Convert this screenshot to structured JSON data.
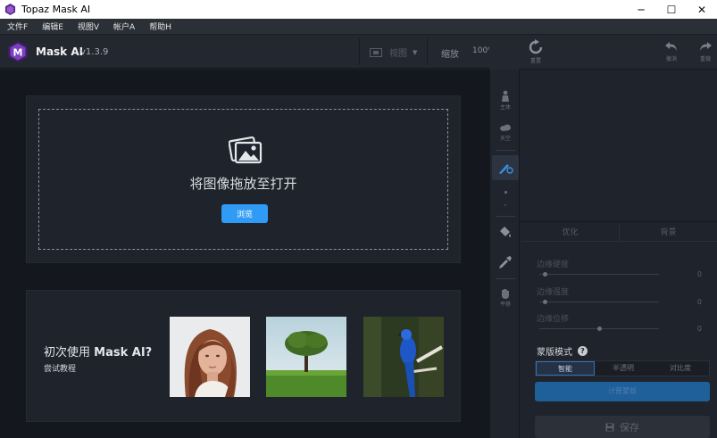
{
  "window": {
    "title": "Topaz Mask AI",
    "min_glyph": "─",
    "max_glyph": "☐",
    "close_glyph": "✕"
  },
  "menu": [
    {
      "label": "文件F"
    },
    {
      "label": "编辑E"
    },
    {
      "label": "视图V"
    },
    {
      "label": "帐户A"
    },
    {
      "label": "帮助H"
    }
  ],
  "toolbar": {
    "app_name": "Mask AI",
    "version": "v1.3.9",
    "view_label": "视图",
    "zoom_label": "缩放",
    "zoom_value": "100%"
  },
  "drop": {
    "text": "将图像拖放至打开",
    "browse_label": "浏览"
  },
  "tutorial": {
    "title_prefix": "初次使用 ",
    "title_bold": "Mask AI?",
    "subtitle": "尝试教程"
  },
  "tools": [
    {
      "name": "主体",
      "label": "主体"
    },
    {
      "name": "天空",
      "label": "天空"
    },
    {
      "name": "brush",
      "label": ""
    },
    {
      "name": "fill",
      "label": ""
    },
    {
      "name": "eyedropper",
      "label": ""
    },
    {
      "name": "平移",
      "label": "平移"
    }
  ],
  "right_panel": {
    "reset_label": "重置",
    "undo_label": "撤消",
    "redo_label": "重做",
    "tabs": [
      "优化",
      "背景"
    ],
    "sliders": [
      {
        "label": "边缘硬度",
        "value": "0",
        "level": 0.05
      },
      {
        "label": "边缘强度",
        "value": "0",
        "level": 0.05
      },
      {
        "label": "边缘位移",
        "value": "0",
        "level": 0.5
      }
    ],
    "mask_mode_label": "蒙版模式",
    "mask_modes": [
      "智能",
      "半透明",
      "对比度"
    ],
    "active_mode": 0,
    "compute_label": "计算蒙版",
    "save_label": "保存"
  },
  "colors": {
    "accent": "#2f9bf5",
    "bg": "#1b1f27"
  }
}
